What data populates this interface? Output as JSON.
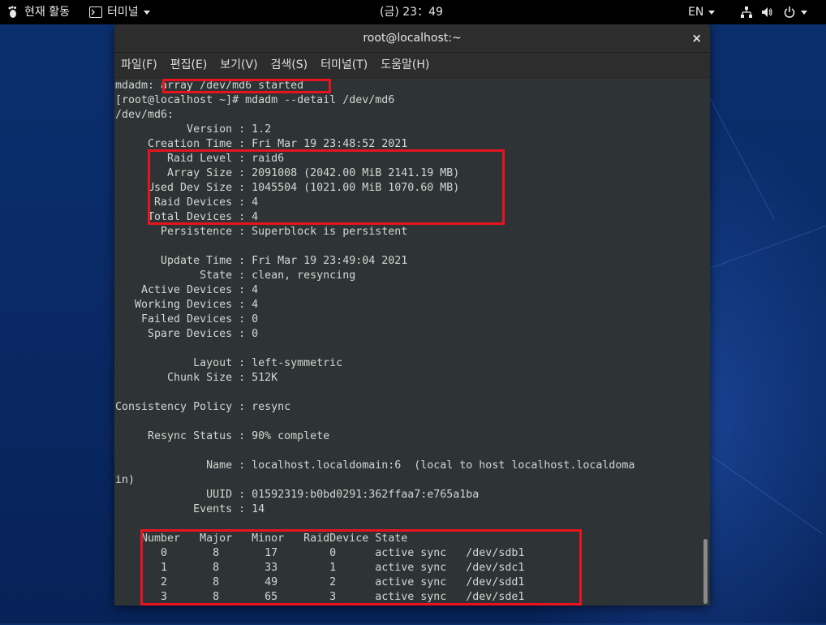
{
  "topbar": {
    "activities": "현재 활동",
    "app_menu": "터미널",
    "clock": "(금) 23：49",
    "input_method": "EN"
  },
  "window": {
    "title": "root@localhost:~",
    "close_label": "×"
  },
  "menu": {
    "file": "파일(F)",
    "edit": "편집(E)",
    "view": "보기(V)",
    "search": "검색(S)",
    "terminal": "터미널(T)",
    "help": "도움말(H)"
  },
  "terminal": {
    "lines": [
      "mdadm: array /dev/md6 started",
      "[root@localhost ~]# mdadm --detail /dev/md6",
      "/dev/md6:",
      "           Version : 1.2",
      "     Creation Time : Fri Mar 19 23:48:52 2021",
      "        Raid Level : raid6",
      "        Array Size : 2091008 (2042.00 MiB 2141.19 MB)",
      "     Used Dev Size : 1045504 (1021.00 MiB 1070.60 MB)",
      "      Raid Devices : 4",
      "     Total Devices : 4",
      "       Persistence : Superblock is persistent",
      "",
      "       Update Time : Fri Mar 19 23:49:04 2021",
      "             State : clean, resyncing",
      "    Active Devices : 4",
      "   Working Devices : 4",
      "    Failed Devices : 0",
      "     Spare Devices : 0",
      "",
      "            Layout : left-symmetric",
      "        Chunk Size : 512K",
      "",
      "Consistency Policy : resync",
      "",
      "     Resync Status : 90% complete",
      "",
      "              Name : localhost.localdomain:6  (local to host localhost.localdoma",
      "in)",
      "              UUID : 01592319:b0bd0291:362ffaa7:e765a1ba",
      "            Events : 14",
      "",
      "    Number   Major   Minor   RaidDevice State",
      "       0       8       17        0      active sync   /dev/sdb1",
      "       1       8       33        1      active sync   /dev/sdc1",
      "       2       8       49        2      active sync   /dev/sdd1",
      "       3       8       65        3      active sync   /dev/sde1"
    ]
  },
  "colors": {
    "highlight": "#e8131f",
    "terminal_bg": "#2e3436",
    "terminal_fg": "#d3d7cf"
  }
}
